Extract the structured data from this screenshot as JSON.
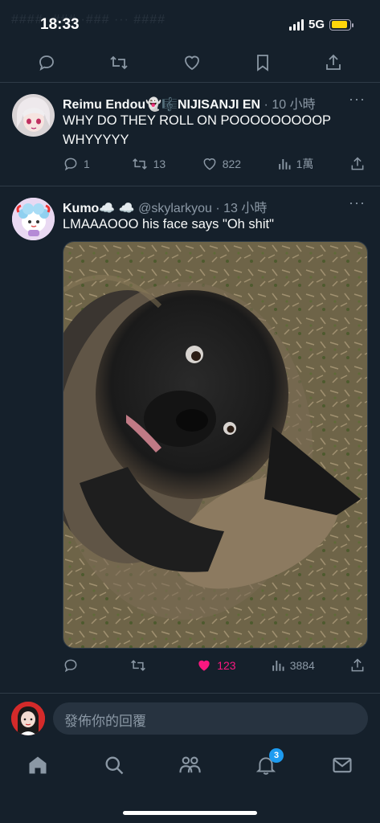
{
  "status": {
    "time": "18:33",
    "network": "5G",
    "battery_level": 0.9,
    "ghost": "#### ·### ·### ··· ####"
  },
  "top_actions": [
    "reply-icon",
    "retweet-icon",
    "like-icon",
    "bookmark-icon",
    "share-icon"
  ],
  "tweets": [
    {
      "name": "Reimu Endou",
      "name_suffix": "👻🎼NIJISANJI EN",
      "meta": "· 10 小時",
      "text": "WHY DO THEY ROLL ON POOOOOOOOOP WHYYYYY",
      "replies": "1",
      "retweets": "13",
      "likes": "822",
      "views": "1萬"
    },
    {
      "name": "Kumo",
      "name_suffix": "☁️ ☁️",
      "handle": "@skylarkyou",
      "meta": "· 13 小時",
      "text": "LMAAAOOO his face says \"Oh shit\"",
      "replies": "",
      "retweets": "",
      "likes": "123",
      "views": "3884",
      "liked": true
    }
  ],
  "reply": {
    "placeholder": "發佈你的回覆"
  },
  "tabs": [
    "home-icon",
    "search-icon",
    "communities-icon",
    "notifications-icon",
    "messages-icon"
  ],
  "notifications_badge": "3",
  "colors": {
    "background": "#15202b",
    "accent": "#1d9bf0",
    "like": "#f91880",
    "muted": "#8b98a5"
  }
}
